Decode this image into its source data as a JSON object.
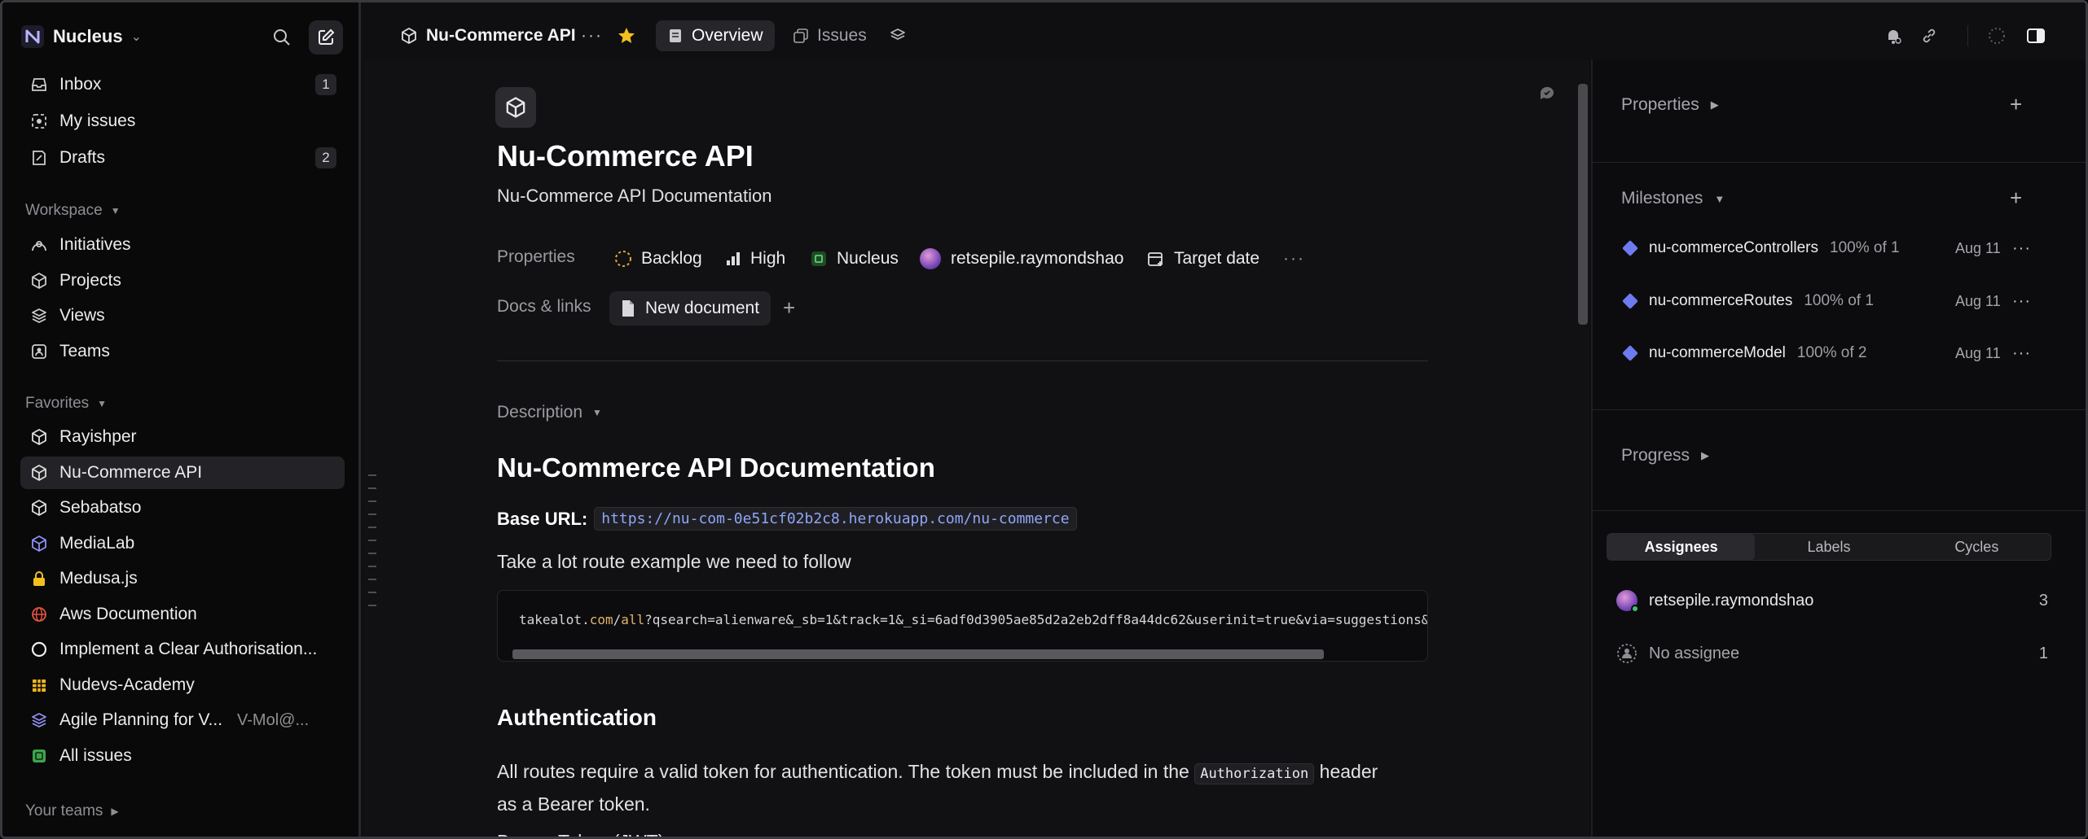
{
  "workspace": {
    "name": "Nucleus"
  },
  "sidebar": {
    "primary": [
      {
        "label": "Inbox",
        "count": "1"
      },
      {
        "label": "My issues"
      },
      {
        "label": "Drafts",
        "count": "2"
      }
    ],
    "workspace_section": "Workspace",
    "workspace_items": [
      {
        "label": "Initiatives"
      },
      {
        "label": "Projects"
      },
      {
        "label": "Views"
      },
      {
        "label": "Teams"
      }
    ],
    "favorites_section": "Favorites",
    "favorites": [
      {
        "label": "Rayishper"
      },
      {
        "label": "Nu-Commerce API"
      },
      {
        "label": "Sebabatso"
      },
      {
        "label": "MediaLab"
      },
      {
        "label": "Medusa.js"
      },
      {
        "label": "Aws Documention"
      },
      {
        "label": "Implement a Clear Authorisation..."
      },
      {
        "label": "Nudevs-Academy"
      },
      {
        "label": "Agile Planning for V...",
        "sub": "V-Mol@..."
      },
      {
        "label": "All issues"
      }
    ],
    "teams_section": "Your teams"
  },
  "topbar": {
    "project": "Nu-Commerce API",
    "tabs": [
      {
        "label": "Overview"
      },
      {
        "label": "Issues"
      }
    ]
  },
  "doc": {
    "title": "Nu-Commerce API",
    "summary": "Nu-Commerce API Documentation",
    "properties_label": "Properties",
    "status": "Backlog",
    "priority": "High",
    "team": "Nucleus",
    "lead": "retsepile.raymondshao",
    "target_date": "Target date",
    "docs_label": "Docs & links",
    "new_document": "New document",
    "description_label": "Description",
    "heading": "Nu-Commerce API Documentation",
    "base_url_label": "Base URL:",
    "base_url": "https://nu-com-0e51cf02b2c8.herokuapp.com/nu-commerce",
    "route_text": "Take a lot route example we need to follow",
    "code_pre": "takealot.",
    "code_kw1": "com",
    "code_sep": "/",
    "code_kw2": "all",
    "code_post": "?qsearch=alienware&_sb=1&track=1&_si=6adf0d3905ae85d2a2eb2dff8a44dc62&userinit=true&via=suggestions&news",
    "auth_heading": "Authentication",
    "auth_text_1": "All routes require a valid token for authentication. The token must be included in the",
    "auth_code": "Authorization",
    "auth_text_2": "header",
    "auth_text_3": "as a Bearer token.",
    "auth_text_4": "Bearer Token (JWT)"
  },
  "panel": {
    "properties": "Properties",
    "milestones": "Milestones",
    "milestone_items": [
      {
        "name": "nu-commerceControllers",
        "pct": "100% of 1",
        "date": "Aug 11"
      },
      {
        "name": "nu-commerceRoutes",
        "pct": "100% of 1",
        "date": "Aug 11"
      },
      {
        "name": "nu-commerceModel",
        "pct": "100% of 2",
        "date": "Aug 11"
      }
    ],
    "progress": "Progress",
    "tabs": [
      "Assignees",
      "Labels",
      "Cycles"
    ],
    "assignees": [
      {
        "name": "retsepile.raymondshao",
        "count": "3"
      },
      {
        "name": "No assignee",
        "count": "1"
      }
    ]
  },
  "colors": {
    "accent": "#6e7bf0",
    "star": "#f2c01e",
    "status_backlog": "#e8a23a",
    "team_green": "#3fa34d"
  }
}
